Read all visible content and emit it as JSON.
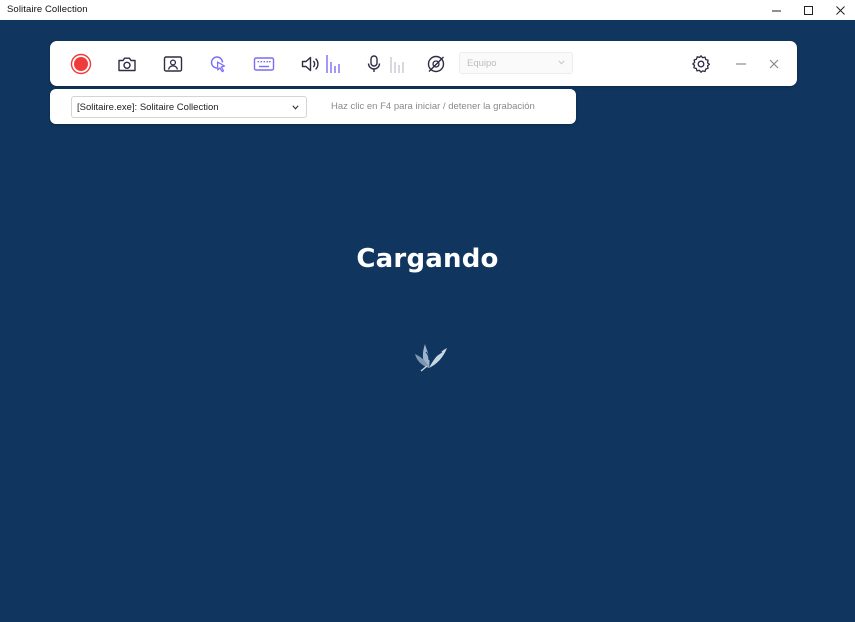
{
  "window": {
    "title": "Solitaire Collection",
    "buttons": [
      "minimize",
      "maximize",
      "close"
    ]
  },
  "toolbar": {
    "icons": [
      "record-icon",
      "camera-icon",
      "webcam-icon",
      "cursor-click-icon",
      "keyboard-icon",
      "speaker-icon",
      "speaker-level-icon",
      "microphone-icon",
      "microphone-level-icon",
      "no-webcam-icon",
      "settings-icon",
      "minimize-icon",
      "close-icon"
    ],
    "audio_source": {
      "value": "Equipo",
      "disabled": true
    },
    "colors": {
      "record": "#ef3b3b",
      "accent": "#7b6cf6",
      "icon": "#2d2d44",
      "level_inactive": "#c8c8d2"
    }
  },
  "capture_bar": {
    "window_select": {
      "value": "[Solitaire.exe]: Solitaire Collection"
    },
    "hint": "Haz clic en F4 para iniciar / detener la grabación"
  },
  "app": {
    "background": "#10365f",
    "loading_text": "Cargando",
    "logo_icon": "solitaire-logo-icon"
  }
}
